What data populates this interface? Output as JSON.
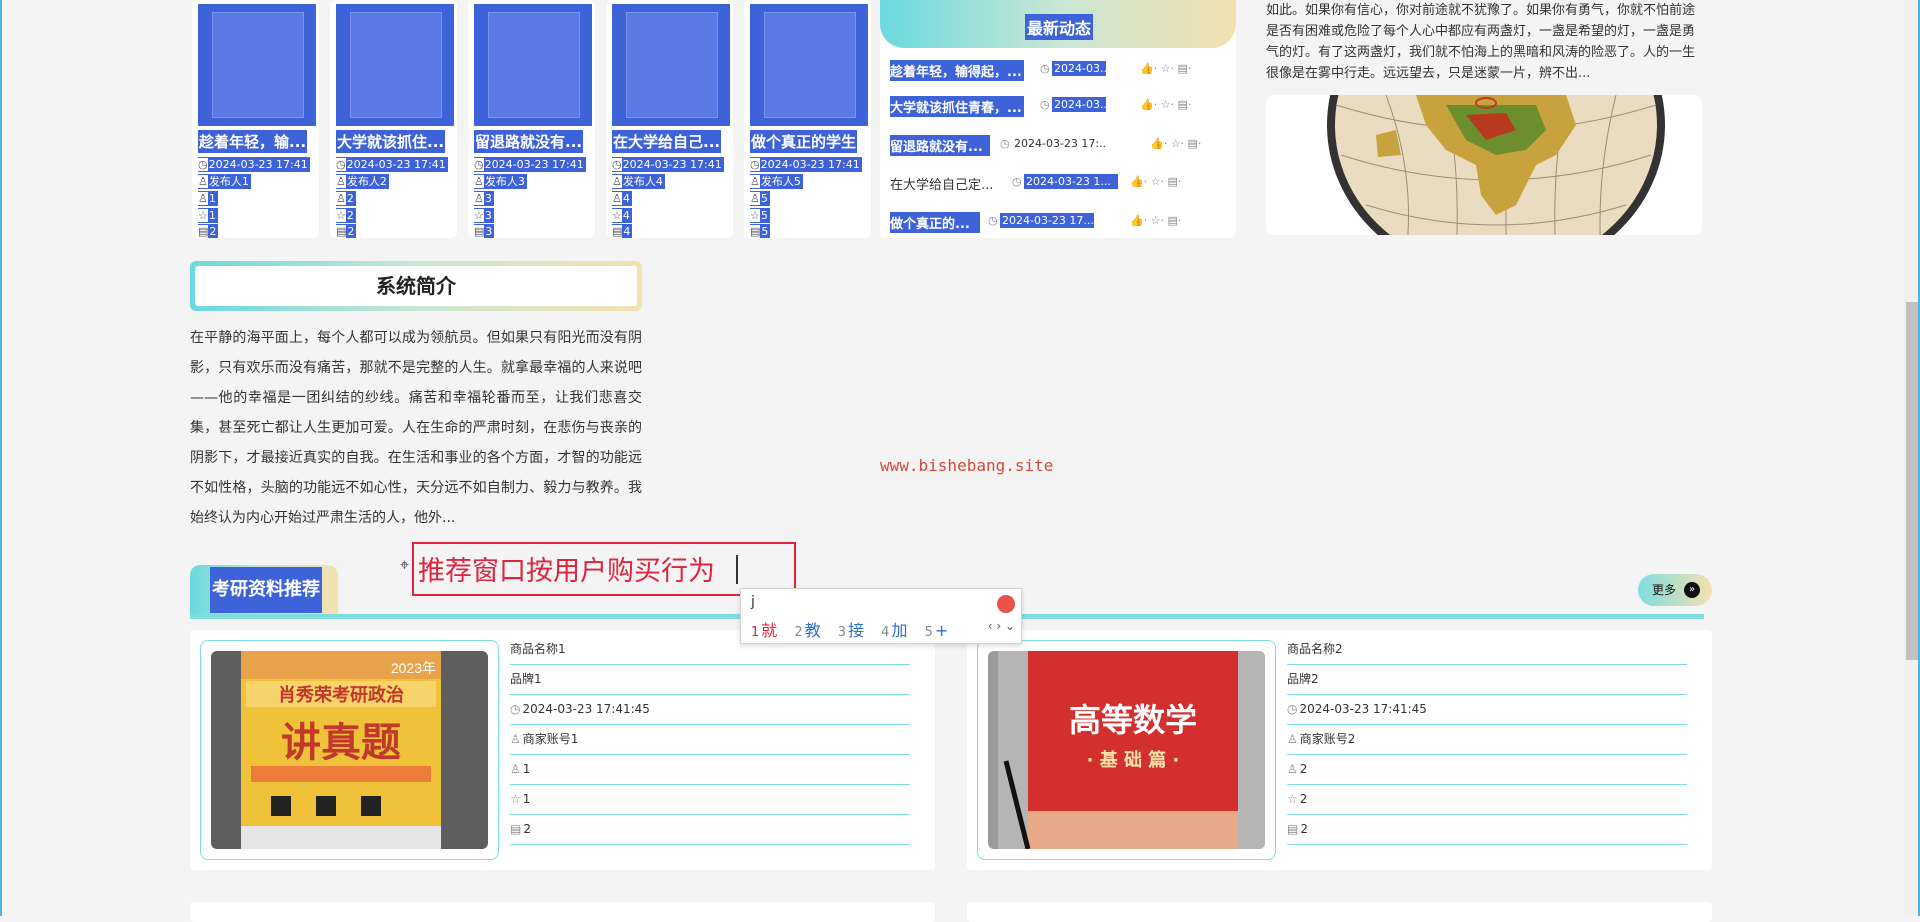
{
  "news_cards": [
    {
      "title": "趁着年轻，输...",
      "date": "2024-03-23 17:41",
      "publisher": "发布人1",
      "likes": "1",
      "favorites": "1",
      "comments": "2"
    },
    {
      "title": "大学就该抓住...",
      "date": "2024-03-23 17:41",
      "publisher": "发布人2",
      "likes": "2",
      "favorites": "2",
      "comments": "2"
    },
    {
      "title": "留退路就没有...",
      "date": "2024-03-23 17:41",
      "publisher": "发布人3",
      "likes": "3",
      "favorites": "3",
      "comments": "3"
    },
    {
      "title": "在大学给自己...",
      "date": "2024-03-23 17:41",
      "publisher": "发布人4",
      "likes": "4",
      "favorites": "4",
      "comments": "4"
    },
    {
      "title": "做个真正的学生",
      "date": "2024-03-23 17:41",
      "publisher": "发布人5",
      "likes": "5",
      "favorites": "5",
      "comments": "5"
    }
  ],
  "latest": {
    "title": "最新动态",
    "items": [
      {
        "title": "趁着年轻，输得起，...",
        "date": "2024-03..."
      },
      {
        "title": "大学就该抓住青春，...",
        "date": "2024-03..."
      },
      {
        "title": "留退路就没有...",
        "date": "2024-03-23 17:..."
      },
      {
        "title": "在大学给自己定...",
        "date": "2024-03-23 1..."
      },
      {
        "title": "做个真正的...",
        "date": "2024-03-23 17..."
      }
    ]
  },
  "right_text": "如此。如果你有信心，你对前途就不犹豫了。如果你有勇气，你就不怕前途是否有困难或危险了每个人心中都应有两盏灯，一盏是希望的灯，一盏是勇气的灯。有了这两盏灯，我们就不怕海上的黑暗和风涛的险恶了。人的一生很像是在雾中行走。远远望去，只是迷蒙一片，辨不出...",
  "intro": {
    "title": "系统简介",
    "text": "在平静的海平面上，每个人都可以成为领航员。但如果只有阳光而没有阴影，只有欢乐而没有痛苦，那就不是完整的人生。就拿最幸福的人来说吧——他的幸福是一团纠结的纱线。痛苦和幸福轮番而至，让我们悲喜交集，甚至死亡都让人生更加可爱。人在生命的严肃时刻，在悲伤与丧亲的阴影下，才最接近真实的自我。在生活和事业的各个方面，才智的功能远不如性格，头脑的功能远不如心性，天分远不如自制力、毅力与教养。我始终认为内心开始过严肃生活的人，他外..."
  },
  "watermark": "www.bishebang.site",
  "recommend": {
    "title": "考研资料推荐",
    "more": "更多",
    "products": [
      {
        "name": "商品名称1",
        "brand": "品牌1",
        "date": "2024-03-23 17:41:45",
        "merchant": "商家账号1",
        "likes": "1",
        "favorites": "1",
        "comments": "2",
        "cover_top": "2023年",
        "cover_series": "肖秀荣考研政治",
        "cover_title": "讲真题"
      },
      {
        "name": "商品名称2",
        "brand": "品牌2",
        "date": "2024-03-23 17:41:45",
        "merchant": "商家账号2",
        "likes": "2",
        "favorites": "2",
        "comments": "2",
        "cover_top": "",
        "cover_series": "",
        "cover_title": "高等数学",
        "cover_sub": "· 基 础 篇 ·"
      }
    ]
  },
  "ime": {
    "typed": "推荐窗口按用户购买行为",
    "composition": "j",
    "candidates": [
      {
        "num": "1",
        "text": "就"
      },
      {
        "num": "2",
        "text": "教"
      },
      {
        "num": "3",
        "text": "接"
      },
      {
        "num": "4",
        "text": "加"
      },
      {
        "num": "5",
        "text": "+"
      }
    ]
  },
  "icons": {
    "clock": "◷",
    "user": "♙",
    "like": "👍",
    "star": "☆",
    "comment": "▤"
  },
  "colors": {
    "accent_blue": "#3e63d8",
    "teal": "#7fdde0",
    "red": "#e0243c",
    "gold": "#f3e1b0"
  }
}
